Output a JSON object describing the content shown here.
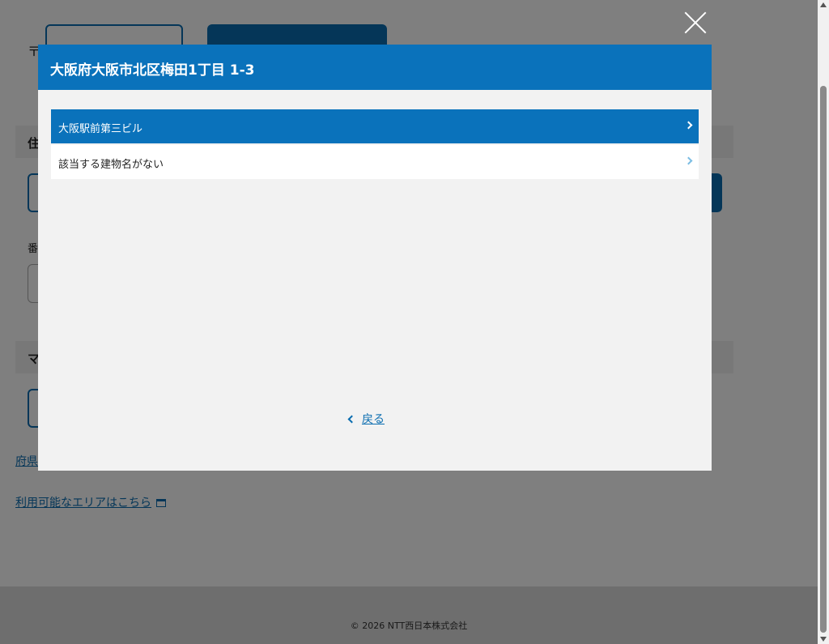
{
  "background": {
    "postal_mark": "〒",
    "address_section_label": "住",
    "number_label": "番",
    "section2_label": "マ",
    "prefecture_link": "府県",
    "area_link": "利用可能なエリアはこちら"
  },
  "modal": {
    "title": "大阪府大阪市北区梅田1丁目 1-3",
    "options": [
      {
        "label": "大阪駅前第三ビル"
      },
      {
        "label": "該当する建物名がない"
      }
    ],
    "back_label": "戻る",
    "close_icon": "close-icon"
  },
  "footer": {
    "copyright": "© 2026 NTT西日本株式会社"
  },
  "colors": {
    "primary": "#0a72bb",
    "link": "#0a6db0"
  }
}
